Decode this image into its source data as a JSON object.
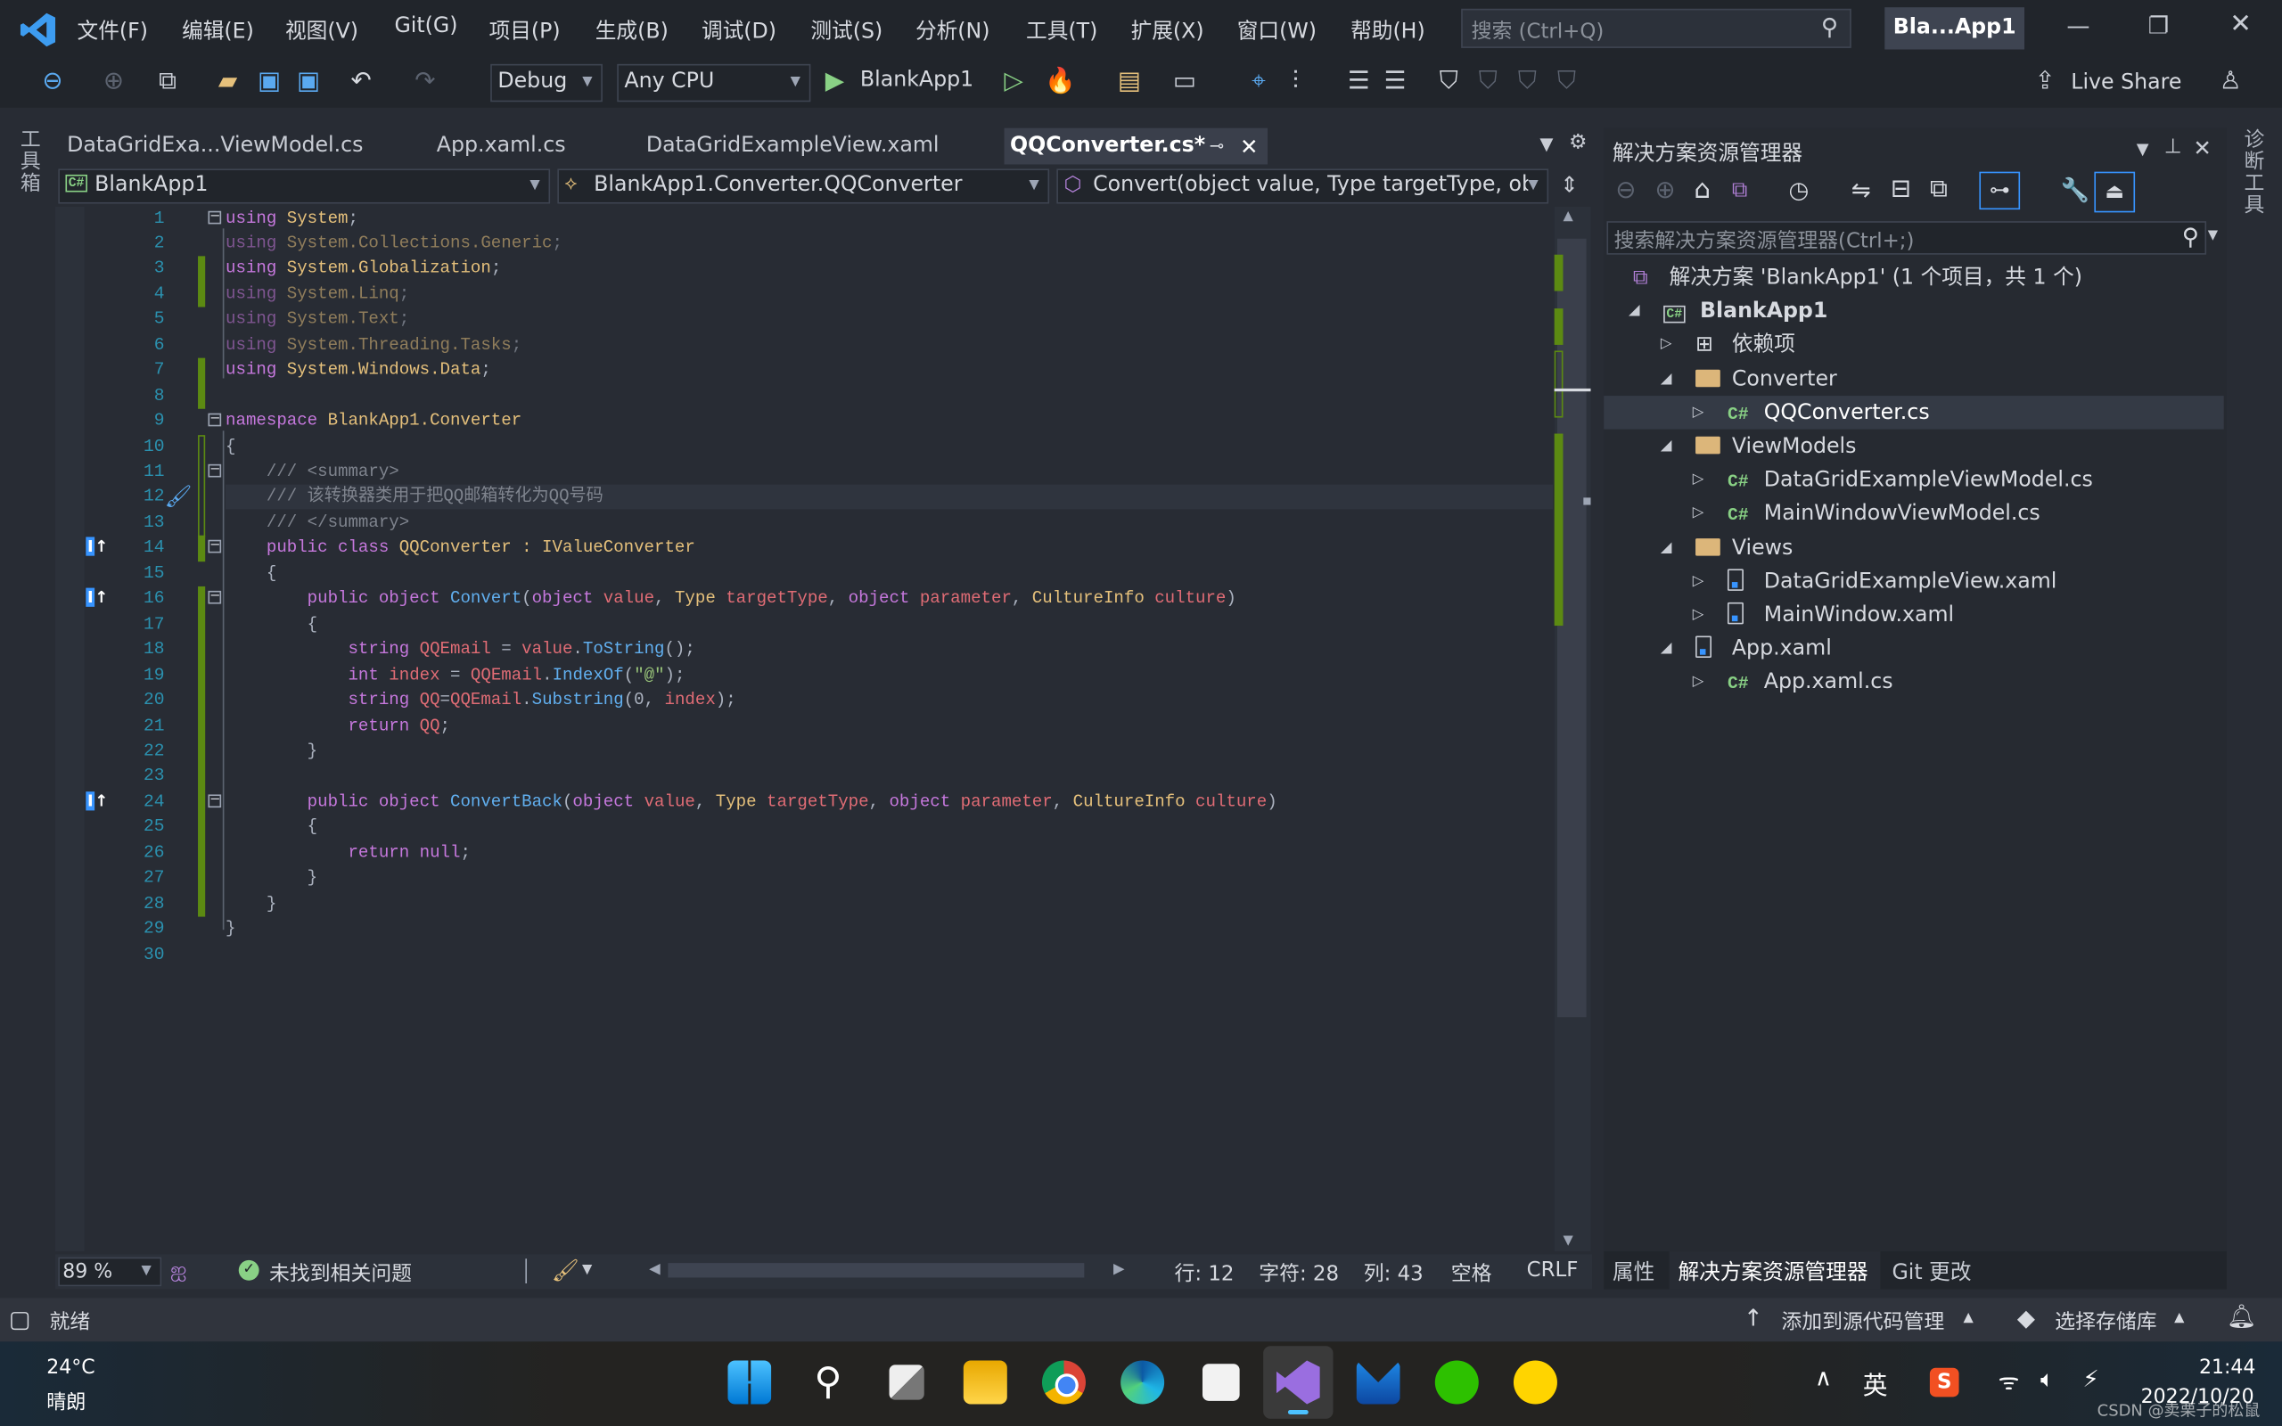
{
  "menu": [
    "文件(F)",
    "编辑(E)",
    "视图(V)",
    "Git(G)",
    "项目(P)",
    "生成(B)",
    "调试(D)",
    "测试(S)",
    "分析(N)",
    "工具(T)",
    "扩展(X)",
    "窗口(W)",
    "帮助(H)"
  ],
  "search": {
    "placeholder": "搜索 (Ctrl+Q)"
  },
  "window_title": "Bla...App1",
  "toolbar": {
    "config": "Debug",
    "platform": "Any CPU",
    "start_label": "BlankApp1",
    "live_share": "Live Share"
  },
  "left_strip": "工具箱",
  "right_strip": "诊断工具",
  "tabs": [
    {
      "label": "DataGridExa...ViewModel.cs",
      "active": false
    },
    {
      "label": "App.xaml.cs",
      "active": false
    },
    {
      "label": "DataGridExampleView.xaml",
      "active": false
    },
    {
      "label": "QQConverter.cs*",
      "active": true
    }
  ],
  "nav": {
    "project": "BlankApp1",
    "type": "BlankApp1.Converter.QQConverter",
    "member": "Convert(object value, Type targetType, ob"
  },
  "code": [
    {
      "n": "1",
      "dim": false,
      "tk": [
        [
          "using",
          "k"
        ],
        [
          " System",
          "t"
        ],
        [
          ";",
          "o"
        ]
      ]
    },
    {
      "n": "2",
      "dim": true,
      "tk": [
        [
          "using",
          "k"
        ],
        [
          " System.Collections.Generic",
          "t"
        ],
        [
          ";",
          "o"
        ]
      ]
    },
    {
      "n": "3",
      "dim": false,
      "tk": [
        [
          "using",
          "k"
        ],
        [
          " System.Globalization",
          "t"
        ],
        [
          ";",
          "o"
        ]
      ]
    },
    {
      "n": "4",
      "dim": true,
      "tk": [
        [
          "using",
          "k"
        ],
        [
          " System.Linq",
          "t"
        ],
        [
          ";",
          "o"
        ]
      ]
    },
    {
      "n": "5",
      "dim": true,
      "tk": [
        [
          "using",
          "k"
        ],
        [
          " System.Text",
          "t"
        ],
        [
          ";",
          "o"
        ]
      ]
    },
    {
      "n": "6",
      "dim": true,
      "tk": [
        [
          "using",
          "k"
        ],
        [
          " System.Threading.Tasks",
          "t"
        ],
        [
          ";",
          "o"
        ]
      ]
    },
    {
      "n": "7",
      "dim": false,
      "tk": [
        [
          "using",
          "k"
        ],
        [
          " System.Windows.Data",
          "t"
        ],
        [
          ";",
          "o"
        ]
      ]
    },
    {
      "n": "8",
      "dim": false,
      "tk": []
    },
    {
      "n": "9",
      "dim": false,
      "tk": [
        [
          "namespace",
          "k"
        ],
        [
          " BlankApp1.Converter",
          "t"
        ]
      ]
    },
    {
      "n": "10",
      "dim": false,
      "tk": [
        [
          "{",
          "o"
        ]
      ]
    },
    {
      "n": "11",
      "dim": false,
      "tk": [
        [
          "    /// <summary>",
          "c"
        ]
      ]
    },
    {
      "n": "12",
      "dim": false,
      "tk": [
        [
          "    /// 该转换器类用于把QQ邮箱转化为QQ号码",
          "c"
        ]
      ]
    },
    {
      "n": "13",
      "dim": false,
      "tk": [
        [
          "    /// </summary>",
          "c"
        ]
      ]
    },
    {
      "n": "14",
      "dim": false,
      "tk": [
        [
          "    public class",
          "k"
        ],
        [
          " QQConverter : IValueConverter",
          "t"
        ]
      ]
    },
    {
      "n": "15",
      "dim": false,
      "tk": [
        [
          "    {",
          "o"
        ]
      ]
    },
    {
      "n": "16",
      "dim": false,
      "tk": [
        [
          "        public object",
          "k"
        ],
        [
          " Convert",
          "m"
        ],
        [
          "(",
          "o"
        ],
        [
          "object",
          "k"
        ],
        [
          " value",
          "p"
        ],
        [
          ", ",
          "o"
        ],
        [
          "Type",
          "t"
        ],
        [
          " targetType",
          "p"
        ],
        [
          ", ",
          "o"
        ],
        [
          "object",
          "k"
        ],
        [
          " parameter",
          "p"
        ],
        [
          ", ",
          "o"
        ],
        [
          "CultureInfo",
          "t"
        ],
        [
          " culture",
          "p"
        ],
        [
          ")",
          "o"
        ]
      ]
    },
    {
      "n": "17",
      "dim": false,
      "tk": [
        [
          "        {",
          "o"
        ]
      ]
    },
    {
      "n": "18",
      "dim": false,
      "tk": [
        [
          "            string",
          "k"
        ],
        [
          " QQEmail",
          "p"
        ],
        [
          " = ",
          "o"
        ],
        [
          "value",
          "p"
        ],
        [
          ".",
          "o"
        ],
        [
          "ToString",
          "m"
        ],
        [
          "();",
          "o"
        ]
      ]
    },
    {
      "n": "19",
      "dim": false,
      "tk": [
        [
          "            int",
          "k"
        ],
        [
          " index",
          "p"
        ],
        [
          " = ",
          "o"
        ],
        [
          "QQEmail",
          "p"
        ],
        [
          ".",
          "o"
        ],
        [
          "IndexOf",
          "m"
        ],
        [
          "(",
          "o"
        ],
        [
          "\"@\"",
          "s"
        ],
        [
          ");",
          "o"
        ]
      ]
    },
    {
      "n": "20",
      "dim": false,
      "tk": [
        [
          "            string",
          "k"
        ],
        [
          " QQ",
          "p"
        ],
        [
          "=",
          "o"
        ],
        [
          "QQEmail",
          "p"
        ],
        [
          ".",
          "o"
        ],
        [
          "Substring",
          "m"
        ],
        [
          "(0, ",
          "o"
        ],
        [
          "index",
          "p"
        ],
        [
          ");",
          "o"
        ]
      ]
    },
    {
      "n": "21",
      "dim": false,
      "tk": [
        [
          "            return",
          "k"
        ],
        [
          " QQ",
          "p"
        ],
        [
          ";",
          "o"
        ]
      ]
    },
    {
      "n": "22",
      "dim": false,
      "tk": [
        [
          "        }",
          "o"
        ]
      ]
    },
    {
      "n": "23",
      "dim": false,
      "tk": []
    },
    {
      "n": "24",
      "dim": false,
      "tk": [
        [
          "        public object",
          "k"
        ],
        [
          " ConvertBack",
          "m"
        ],
        [
          "(",
          "o"
        ],
        [
          "object",
          "k"
        ],
        [
          " value",
          "p"
        ],
        [
          ", ",
          "o"
        ],
        [
          "Type",
          "t"
        ],
        [
          " targetType",
          "p"
        ],
        [
          ", ",
          "o"
        ],
        [
          "object",
          "k"
        ],
        [
          " parameter",
          "p"
        ],
        [
          ", ",
          "o"
        ],
        [
          "CultureInfo",
          "t"
        ],
        [
          " culture",
          "p"
        ],
        [
          ")",
          "o"
        ]
      ]
    },
    {
      "n": "25",
      "dim": false,
      "tk": [
        [
          "        {",
          "o"
        ]
      ]
    },
    {
      "n": "26",
      "dim": false,
      "tk": [
        [
          "            return null",
          "k"
        ],
        [
          ";",
          "o"
        ]
      ]
    },
    {
      "n": "27",
      "dim": false,
      "tk": [
        [
          "        }",
          "o"
        ]
      ]
    },
    {
      "n": "28",
      "dim": false,
      "tk": [
        [
          "    }",
          "o"
        ]
      ]
    },
    {
      "n": "29",
      "dim": false,
      "tk": [
        [
          "}",
          "o"
        ]
      ]
    },
    {
      "n": "30",
      "dim": false,
      "tk": []
    }
  ],
  "editor_status": {
    "zoom": "89 %",
    "issues": "未找到相关问题",
    "line": "行: 12",
    "char": "字符: 28",
    "col": "列: 43",
    "spaces": "空格",
    "eol": "CRLF"
  },
  "solution_explorer": {
    "title": "解决方案资源管理器",
    "search_placeholder": "搜索解决方案资源管理器(Ctrl+;)",
    "items": [
      {
        "label": "解决方案 'BlankApp1' (1 个项目，共 1 个)",
        "icon": "solution-icon",
        "depth": 0,
        "state": "none"
      },
      {
        "label": "BlankApp1",
        "icon": "csharp-project-icon",
        "depth": 1,
        "state": "expanded"
      },
      {
        "label": "依赖项",
        "icon": "dependencies-icon",
        "depth": 2,
        "state": "collapsed"
      },
      {
        "label": "Converter",
        "icon": "folder-icon",
        "depth": 2,
        "state": "expanded"
      },
      {
        "label": "QQConverter.cs",
        "icon": "csharp-file-icon",
        "depth": 3,
        "state": "collapsed",
        "selected": true
      },
      {
        "label": "ViewModels",
        "icon": "folder-icon",
        "depth": 2,
        "state": "expanded"
      },
      {
        "label": "DataGridExampleViewModel.cs",
        "icon": "csharp-file-icon",
        "depth": 3,
        "state": "collapsed"
      },
      {
        "label": "MainWindowViewModel.cs",
        "icon": "csharp-file-icon",
        "depth": 3,
        "state": "collapsed"
      },
      {
        "label": "Views",
        "icon": "folder-icon",
        "depth": 2,
        "state": "expanded"
      },
      {
        "label": "DataGridExampleView.xaml",
        "icon": "xaml-file-icon",
        "depth": 3,
        "state": "collapsed"
      },
      {
        "label": "MainWindow.xaml",
        "icon": "xaml-file-icon",
        "depth": 3,
        "state": "collapsed"
      },
      {
        "label": "App.xaml",
        "icon": "xaml-file-icon",
        "depth": 2,
        "state": "expanded"
      },
      {
        "label": "App.xaml.cs",
        "icon": "csharp-file-icon",
        "depth": 3,
        "state": "collapsed"
      }
    ],
    "bottom_tabs": [
      "属性",
      "解决方案资源管理器",
      "Git 更改"
    ]
  },
  "statusbar": {
    "ready": "就绪",
    "add_source": "添加到源代码管理",
    "select_repo": "选择存储库"
  },
  "taskbar": {
    "weather_temp": "24°C",
    "weather_desc": "晴朗",
    "apps": [
      "start",
      "search",
      "task-view",
      "file-explorer",
      "chrome",
      "edge",
      "snipping-tool",
      "visual-studio",
      "mail",
      "wechat",
      "qq-music"
    ],
    "ime": "英",
    "time": "21:44",
    "date": "2022/10/20"
  },
  "watermark": "CSDN @卖栗子的松鼠",
  "colors": {
    "accent": "#3794ff",
    "change_bar": "#5c8a12",
    "keyword": "#c678dd",
    "type": "#e5c07b",
    "method": "#61afef",
    "param": "#e06c75",
    "string": "#98c379",
    "comment": "#7f848e"
  }
}
